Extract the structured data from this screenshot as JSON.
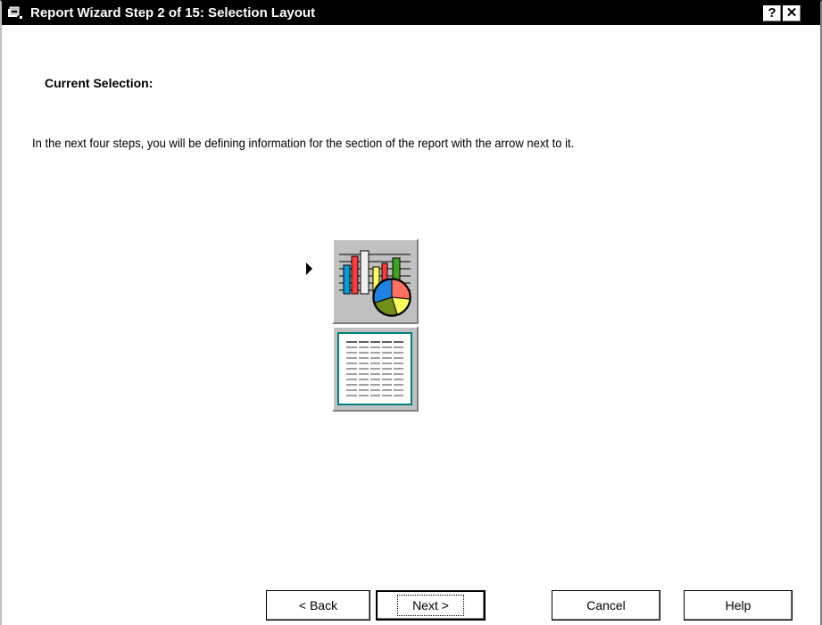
{
  "window": {
    "title": "Report Wizard Step 2 of 15: Selection Layout",
    "help_button": "?",
    "close_button": "✕"
  },
  "content": {
    "heading": "Current Selection:",
    "description": "In the next four steps, you will be defining information for the section of the report with the arrow next to it."
  },
  "layout_sections": [
    {
      "name": "chart-section",
      "icon": "chart-icon",
      "selected": true
    },
    {
      "name": "table-section",
      "icon": "table-icon",
      "selected": false
    }
  ],
  "buttons": {
    "back": "< Back",
    "next": "Next >",
    "cancel": "Cancel",
    "help": "Help"
  },
  "colors": {
    "titlebar": "#000000",
    "tile_face": "#c0c0c0",
    "bar_blue": "#00a0e0",
    "bar_red": "#ff3c3c",
    "bar_yellow": "#ffff60",
    "bar_green": "#40a020"
  }
}
